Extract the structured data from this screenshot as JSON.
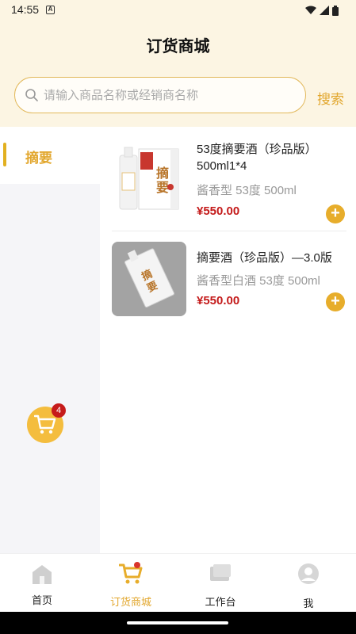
{
  "status_bar": {
    "time": "14:55",
    "notification_letter": "A"
  },
  "header": {
    "title": "订货商城"
  },
  "search": {
    "placeholder": "请输入商品名称或经销商名称",
    "button_label": "搜索"
  },
  "categories": [
    {
      "label": "摘要",
      "selected": true
    }
  ],
  "products": [
    {
      "name": "53度摘要酒（珍品版）500ml1*4",
      "spec": "酱香型 53度 500ml",
      "price": "¥550.00",
      "add_label": "+"
    },
    {
      "name": "摘要酒（珍品版）—3.0版",
      "spec": "酱香型白酒 53度 500ml",
      "price": "¥550.00",
      "add_label": "+"
    }
  ],
  "cart": {
    "badge_count": "4"
  },
  "bottom_nav": [
    {
      "label": "首页",
      "icon": "home-icon",
      "active": false
    },
    {
      "label": "订货商城",
      "icon": "shopping-cart-icon",
      "active": true
    },
    {
      "label": "工作台",
      "icon": "workbench-icon",
      "active": false
    },
    {
      "label": "我",
      "icon": "user-icon",
      "active": false
    }
  ],
  "colors": {
    "accent": "#e2a72e",
    "price": "#c41a1a",
    "header_bg": "#fcf5e3",
    "badge": "#c61b1b"
  }
}
